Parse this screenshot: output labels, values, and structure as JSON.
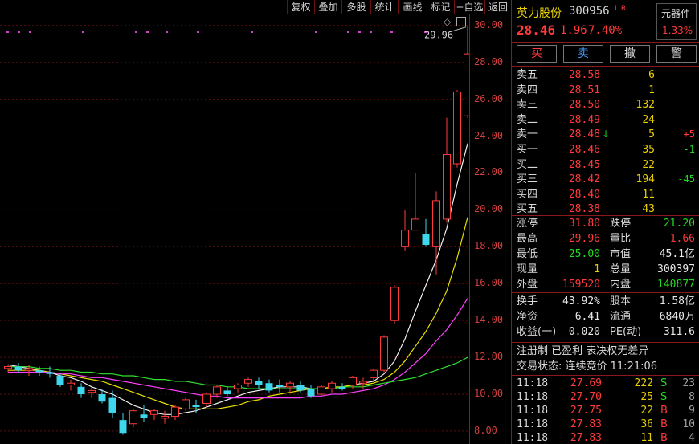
{
  "toolbar": {
    "buttons": [
      "复权",
      "叠加",
      "多股",
      "统计",
      "画线",
      "标记",
      "+自选",
      "返回"
    ]
  },
  "chart_data": {
    "type": "candlestick",
    "y_ticks": [
      "30.00",
      "28.00",
      "26.00",
      "24.00",
      "22.00",
      "20.00",
      "18.00",
      "16.00",
      "14.00",
      "12.00",
      "10.00",
      "8.00"
    ],
    "ylim": [
      7.3,
      30.6
    ],
    "high_annotation": "29.96",
    "candles": [
      [
        11.4,
        11.6,
        11.2,
        11.5
      ],
      [
        11.5,
        11.7,
        11.2,
        11.3
      ],
      [
        11.3,
        11.6,
        11.0,
        11.4
      ],
      [
        11.3,
        11.5,
        11.0,
        11.2
      ],
      [
        11.2,
        11.5,
        10.9,
        11.1
      ],
      [
        11.0,
        11.1,
        10.4,
        10.5
      ],
      [
        10.5,
        10.8,
        10.2,
        10.6
      ],
      [
        10.4,
        10.6,
        9.8,
        10.0
      ],
      [
        10.1,
        10.4,
        9.8,
        10.2
      ],
      [
        10.0,
        10.3,
        9.5,
        9.6
      ],
      [
        9.8,
        10.2,
        8.7,
        9.0
      ],
      [
        8.6,
        9.0,
        7.8,
        7.9
      ],
      [
        8.4,
        9.2,
        8.2,
        9.1
      ],
      [
        8.9,
        9.4,
        8.5,
        8.7
      ],
      [
        8.9,
        9.2,
        8.6,
        9.1
      ],
      [
        8.7,
        9.1,
        8.4,
        8.8
      ],
      [
        8.8,
        9.4,
        8.6,
        9.3
      ],
      [
        9.2,
        9.8,
        9.1,
        9.7
      ],
      [
        9.4,
        9.7,
        9.0,
        9.3
      ],
      [
        9.5,
        10.1,
        9.3,
        10.0
      ],
      [
        10.0,
        10.5,
        9.8,
        10.4
      ],
      [
        10.2,
        10.4,
        9.9,
        10.0
      ],
      [
        10.3,
        10.6,
        10.1,
        10.5
      ],
      [
        10.6,
        10.9,
        10.4,
        10.8
      ],
      [
        10.7,
        10.9,
        10.3,
        10.5
      ],
      [
        10.6,
        10.8,
        10.1,
        10.2
      ],
      [
        10.5,
        10.8,
        10.1,
        10.4
      ],
      [
        10.4,
        10.7,
        10.1,
        10.6
      ],
      [
        10.5,
        10.7,
        10.1,
        10.2
      ],
      [
        10.3,
        10.5,
        9.8,
        9.9
      ],
      [
        10.0,
        10.5,
        9.9,
        10.4
      ],
      [
        10.3,
        10.7,
        10.1,
        10.6
      ],
      [
        10.4,
        10.6,
        10.2,
        10.3
      ],
      [
        10.5,
        11.0,
        10.3,
        10.9
      ],
      [
        10.6,
        10.9,
        10.3,
        10.7
      ],
      [
        10.9,
        11.4,
        10.7,
        11.3
      ],
      [
        11.3,
        13.2,
        11.2,
        13.1
      ],
      [
        14.0,
        15.9,
        13.8,
        15.8
      ],
      [
        18.0,
        20.0,
        17.8,
        18.9
      ],
      [
        18.9,
        22.0,
        19.0,
        19.5
      ],
      [
        18.7,
        19.5,
        18.0,
        18.1
      ],
      [
        18.0,
        21.0,
        16.5,
        20.5
      ],
      [
        19.5,
        25.0,
        19.3,
        23.0
      ],
      [
        22.5,
        26.5,
        22.3,
        26.4
      ],
      [
        25.1,
        29.96,
        25.0,
        28.46
      ]
    ],
    "ma_series": [
      {
        "color": "#f0f0f0",
        "values": [
          11.6,
          11.5,
          11.4,
          11.3,
          11.2,
          11.0,
          10.9,
          10.7,
          10.4,
          10.2,
          10.0,
          9.7,
          9.4,
          9.2,
          9.0,
          8.9,
          8.9,
          9.0,
          9.1,
          9.3,
          9.5,
          9.7,
          9.9,
          10.1,
          10.2,
          10.3,
          10.4,
          10.4,
          10.4,
          10.3,
          10.3,
          10.3,
          10.4,
          10.5,
          10.6,
          10.7,
          11.1,
          11.8,
          13.0,
          14.5,
          15.9,
          17.3,
          19.0,
          21.4,
          23.6
        ]
      },
      {
        "color": "#e8e000",
        "values": [
          11.3,
          11.3,
          11.3,
          11.3,
          11.2,
          11.1,
          11.0,
          10.9,
          10.8,
          10.7,
          10.5,
          10.3,
          10.1,
          9.9,
          9.7,
          9.5,
          9.3,
          9.2,
          9.2,
          9.2,
          9.2,
          9.3,
          9.4,
          9.6,
          9.7,
          9.9,
          10.0,
          10.1,
          10.2,
          10.3,
          10.3,
          10.4,
          10.4,
          10.5,
          10.5,
          10.6,
          10.8,
          11.2,
          11.8,
          12.6,
          13.4,
          14.4,
          15.6,
          17.4,
          19.6
        ]
      },
      {
        "color": "#ff40ff",
        "values": [
          11.2,
          11.2,
          11.2,
          11.2,
          11.2,
          11.1,
          11.1,
          11.0,
          10.9,
          10.9,
          10.8,
          10.7,
          10.6,
          10.5,
          10.4,
          10.3,
          10.2,
          10.1,
          10.0,
          9.9,
          9.9,
          9.8,
          9.8,
          9.8,
          9.8,
          9.8,
          9.8,
          9.8,
          9.8,
          9.9,
          9.9,
          10.0,
          10.0,
          10.1,
          10.2,
          10.3,
          10.5,
          10.8,
          11.2,
          11.7,
          12.2,
          12.9,
          13.5,
          14.3,
          15.2
        ]
      },
      {
        "color": "#30e030",
        "values": [
          11.5,
          11.5,
          11.5,
          11.4,
          11.4,
          11.3,
          11.3,
          11.2,
          11.2,
          11.1,
          11.1,
          11.0,
          11.0,
          10.9,
          10.8,
          10.8,
          10.7,
          10.7,
          10.6,
          10.5,
          10.5,
          10.4,
          10.4,
          10.3,
          10.3,
          10.3,
          10.3,
          10.3,
          10.3,
          10.3,
          10.3,
          10.3,
          10.4,
          10.4,
          10.4,
          10.5,
          10.6,
          10.7,
          10.8,
          10.9,
          11.1,
          11.3,
          11.5,
          11.7,
          12.0
        ]
      }
    ]
  },
  "panel": {
    "name": "英力股份",
    "code": "300956",
    "tag": "L R",
    "yuan_label": "元器件",
    "yuan_pct": "1.33%",
    "price": "28.46",
    "change": "1.96",
    "change_pct": "7.40%",
    "buttons": [
      "买",
      "卖",
      "撤",
      "警"
    ],
    "sells": [
      {
        "label": "卖五",
        "price": "28.58",
        "vol": "6",
        "chg": ""
      },
      {
        "label": "卖四",
        "price": "28.51",
        "vol": "1",
        "chg": ""
      },
      {
        "label": "卖三",
        "price": "28.50",
        "vol": "132",
        "chg": ""
      },
      {
        "label": "卖二",
        "price": "28.49",
        "vol": "24",
        "chg": ""
      },
      {
        "label": "卖一",
        "price": "28.48",
        "vol": "5",
        "chg": "+5",
        "arrow": "↓"
      }
    ],
    "buys": [
      {
        "label": "买一",
        "price": "28.46",
        "vol": "35",
        "chg": "-1"
      },
      {
        "label": "买二",
        "price": "28.45",
        "vol": "22",
        "chg": ""
      },
      {
        "label": "买三",
        "price": "28.42",
        "vol": "194",
        "chg": "-45"
      },
      {
        "label": "买四",
        "price": "28.40",
        "vol": "11",
        "chg": ""
      },
      {
        "label": "买五",
        "price": "28.38",
        "vol": "43",
        "chg": ""
      }
    ],
    "stats": [
      {
        "l1": "涨停",
        "v1": "31.80",
        "c1": "red",
        "l2": "跌停",
        "v2": "21.20",
        "c2": "green"
      },
      {
        "l1": "最高",
        "v1": "29.96",
        "c1": "red",
        "l2": "量比",
        "v2": "1.66",
        "c2": "red"
      },
      {
        "l1": "最低",
        "v1": "25.00",
        "c1": "green",
        "l2": "市值",
        "v2": "45.1亿",
        "c2": "white"
      },
      {
        "l1": "现量",
        "v1": "1",
        "c1": "yellow",
        "l2": "总量",
        "v2": "300397",
        "c2": "white"
      },
      {
        "l1": "外盘",
        "v1": "159520",
        "c1": "red",
        "l2": "内盘",
        "v2": "140877",
        "c2": "green"
      }
    ],
    "fin": [
      {
        "l1": "换手",
        "v1": "43.92%",
        "l2": "股本",
        "v2": "1.58亿"
      },
      {
        "l1": "净资",
        "v1": "6.41",
        "l2": "流通",
        "v2": "6840万"
      },
      {
        "l1": "收益(一)",
        "v1": "0.020",
        "l2": "PE(动)",
        "v2": "311.6"
      }
    ],
    "notes": "注册制 已盈利 表决权无差异",
    "trade_status": "交易状态: 连续竞价 11:21:06",
    "ticks": [
      {
        "time": "11:18",
        "price": "27.69",
        "vol": "222",
        "side": "S",
        "n": "23"
      },
      {
        "time": "11:18",
        "price": "27.70",
        "vol": "25",
        "side": "S",
        "n": "8"
      },
      {
        "time": "11:18",
        "price": "27.75",
        "vol": "22",
        "side": "B",
        "n": "9"
      },
      {
        "time": "11:18",
        "price": "27.83",
        "vol": "36",
        "side": "B",
        "n": "10"
      },
      {
        "time": "11:18",
        "price": "27.83",
        "vol": "11",
        "side": "B",
        "n": "4"
      }
    ]
  }
}
